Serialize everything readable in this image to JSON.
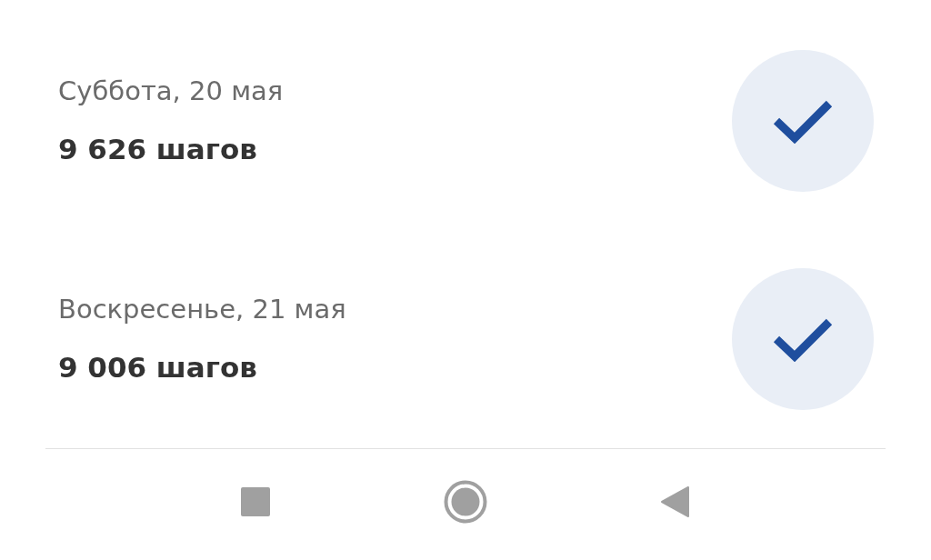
{
  "days": [
    {
      "date": "Суббота, 20 мая",
      "steps": "9 626 шагов",
      "goal_reached": true
    },
    {
      "date": "Воскресенье, 21 мая",
      "steps": "9 006 шагов",
      "goal_reached": true
    }
  ],
  "nav_bar": {
    "buttons": [
      {
        "kind": "recents"
      },
      {
        "kind": "home"
      },
      {
        "kind": "back"
      }
    ]
  }
}
